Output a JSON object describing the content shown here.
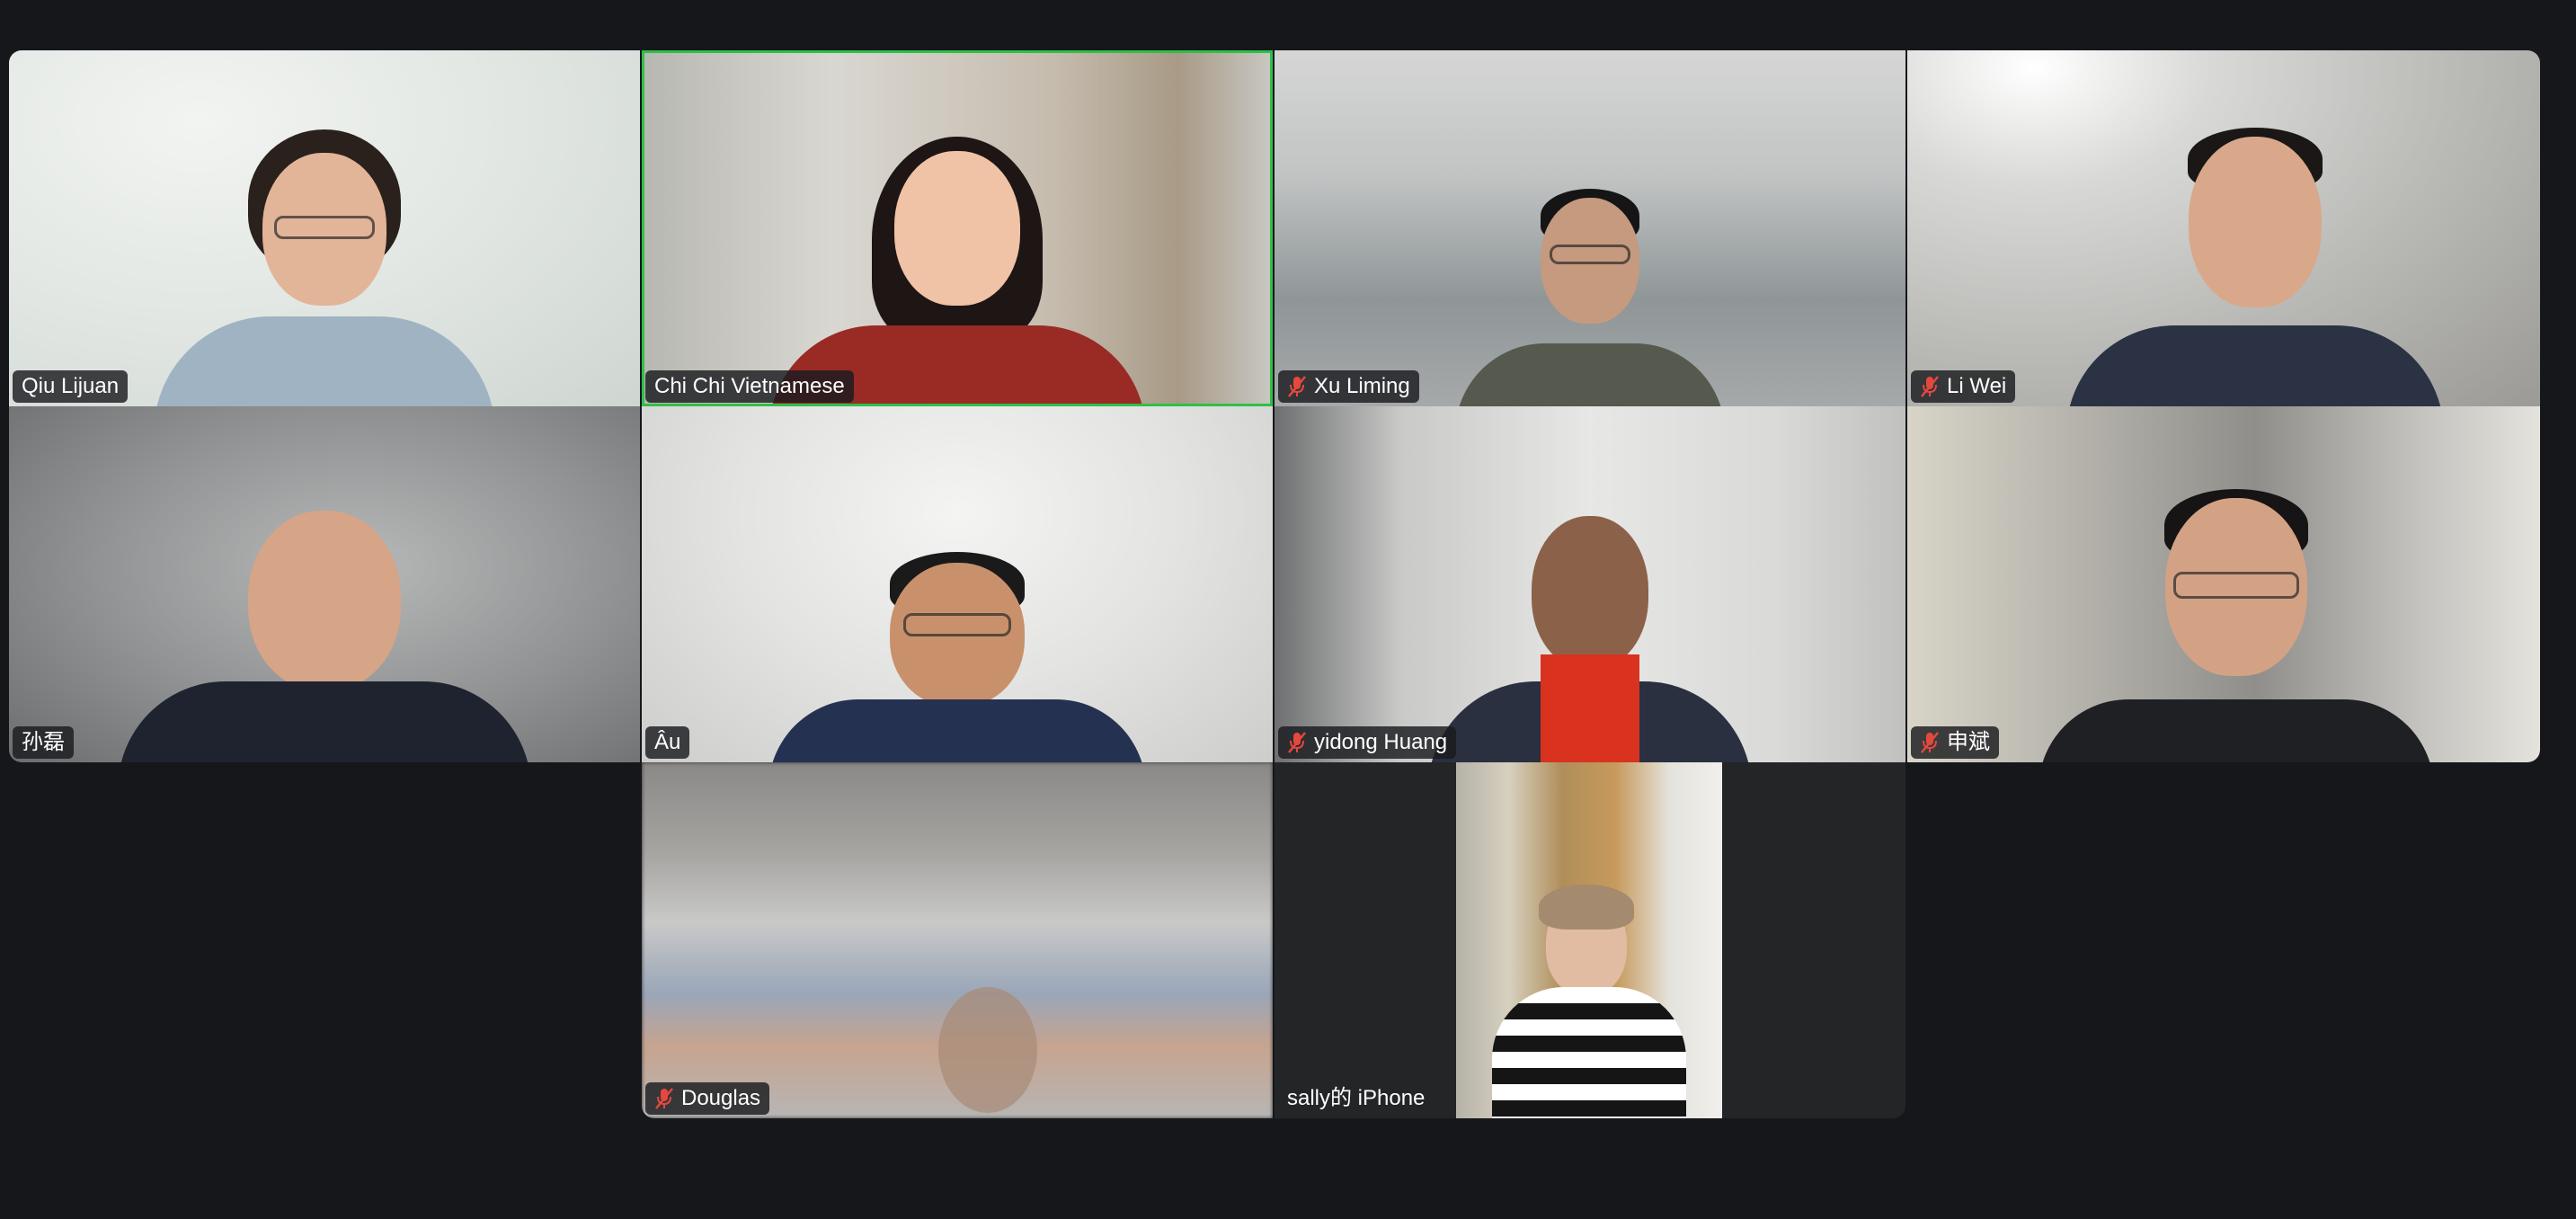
{
  "meeting": {
    "view_mode": "gallery",
    "active_speaker_color": "#2fbf4a",
    "muted_icon_color": "#e5483e"
  },
  "participants": [
    {
      "name": "Qiu Lijuan",
      "muted": false,
      "active_speaker": false
    },
    {
      "name": "Chi Chi Vietnamese",
      "muted": false,
      "active_speaker": true
    },
    {
      "name": "Xu Liming",
      "muted": true,
      "active_speaker": false
    },
    {
      "name": "Li Wei",
      "muted": true,
      "active_speaker": false
    },
    {
      "name": "孙磊",
      "muted": false,
      "active_speaker": false
    },
    {
      "name": "Âu",
      "muted": false,
      "active_speaker": false
    },
    {
      "name": "yidong Huang",
      "muted": true,
      "active_speaker": false
    },
    {
      "name": "申斌",
      "muted": true,
      "active_speaker": false
    },
    {
      "name": "Douglas",
      "muted": true,
      "active_speaker": false
    },
    {
      "name": "sally的 iPhone",
      "muted": false,
      "active_speaker": false
    }
  ],
  "icons": {
    "muted": "microphone-muted-icon"
  }
}
